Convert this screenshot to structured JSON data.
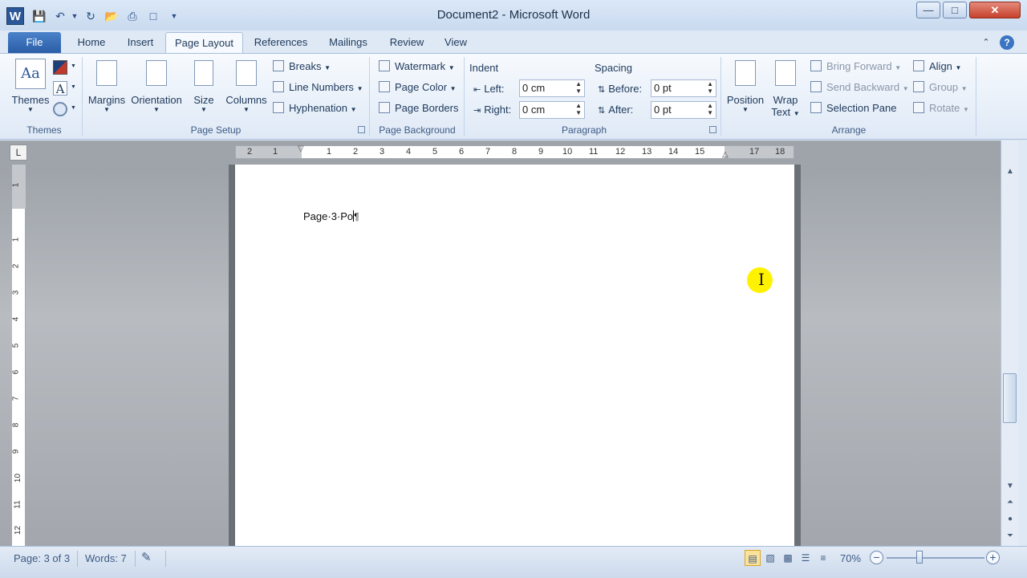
{
  "window": {
    "title": "Document2 - Microsoft Word",
    "app_icon": "W"
  },
  "quick_access": [
    "save-icon",
    "undo-icon",
    "redo-icon",
    "open-icon",
    "print-icon",
    "new-icon",
    "customize-icon"
  ],
  "tabs": [
    {
      "label": "File"
    },
    {
      "label": "Home"
    },
    {
      "label": "Insert"
    },
    {
      "label": "Page Layout"
    },
    {
      "label": "References"
    },
    {
      "label": "Mailings"
    },
    {
      "label": "Review"
    },
    {
      "label": "View"
    }
  ],
  "ribbon": {
    "themes": {
      "themes_label": "Themes",
      "group": "Themes",
      "aa": "Aa"
    },
    "page_setup": {
      "margins": "Margins",
      "orientation": "Orientation",
      "size": "Size",
      "columns": "Columns",
      "breaks": "Breaks",
      "line_numbers": "Line Numbers",
      "hyphenation": "Hyphenation",
      "group": "Page Setup"
    },
    "page_background": {
      "watermark": "Watermark",
      "page_color": "Page Color",
      "page_borders": "Page Borders",
      "group": "Page Background"
    },
    "paragraph": {
      "indent_title": "Indent",
      "left_label": "Left:",
      "left_value": "0 cm",
      "right_label": "Right:",
      "right_value": "0 cm",
      "spacing_title": "Spacing",
      "before_label": "Before:",
      "before_value": "0 pt",
      "after_label": "After:",
      "after_value": "0 pt",
      "group": "Paragraph"
    },
    "arrange": {
      "position": "Position",
      "wrap_text_1": "Wrap",
      "wrap_text_2": "Text",
      "bring_forward": "Bring Forward",
      "send_backward": "Send Backward",
      "selection_pane": "Selection Pane",
      "align": "Align",
      "group_btn": "Group",
      "rotate": "Rotate",
      "group": "Arrange"
    }
  },
  "ruler": {
    "corner": "L",
    "ticks": [
      "2",
      "1",
      "1",
      "2",
      "3",
      "4",
      "5",
      "6",
      "7",
      "8",
      "9",
      "10",
      "11",
      "12",
      "13",
      "14",
      "15",
      "17",
      "18"
    ],
    "vticks": [
      "1",
      "1",
      "2",
      "3",
      "4",
      "5",
      "6",
      "7",
      "8",
      "9",
      "10",
      "11",
      "12"
    ]
  },
  "document": {
    "text": "Page·3·Po"
  },
  "status": {
    "page": "Page: 3 of 3",
    "words": "Words: 7",
    "zoom": "70%",
    "zoom_level_percent": 70
  }
}
